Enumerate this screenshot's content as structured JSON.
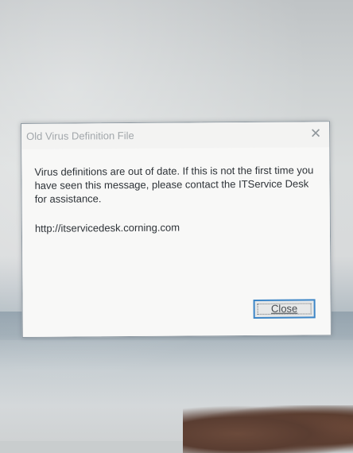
{
  "dialog": {
    "title": "Old Virus Definition File",
    "close_glyph": "✕",
    "close_icon": "close-icon",
    "message": "Virus definitions are out of date. If this is not the first time you have seen this message, please contact the ITService Desk for assistance.",
    "url": "http://itservicedesk.corning.com",
    "close_button_label": "Close"
  }
}
